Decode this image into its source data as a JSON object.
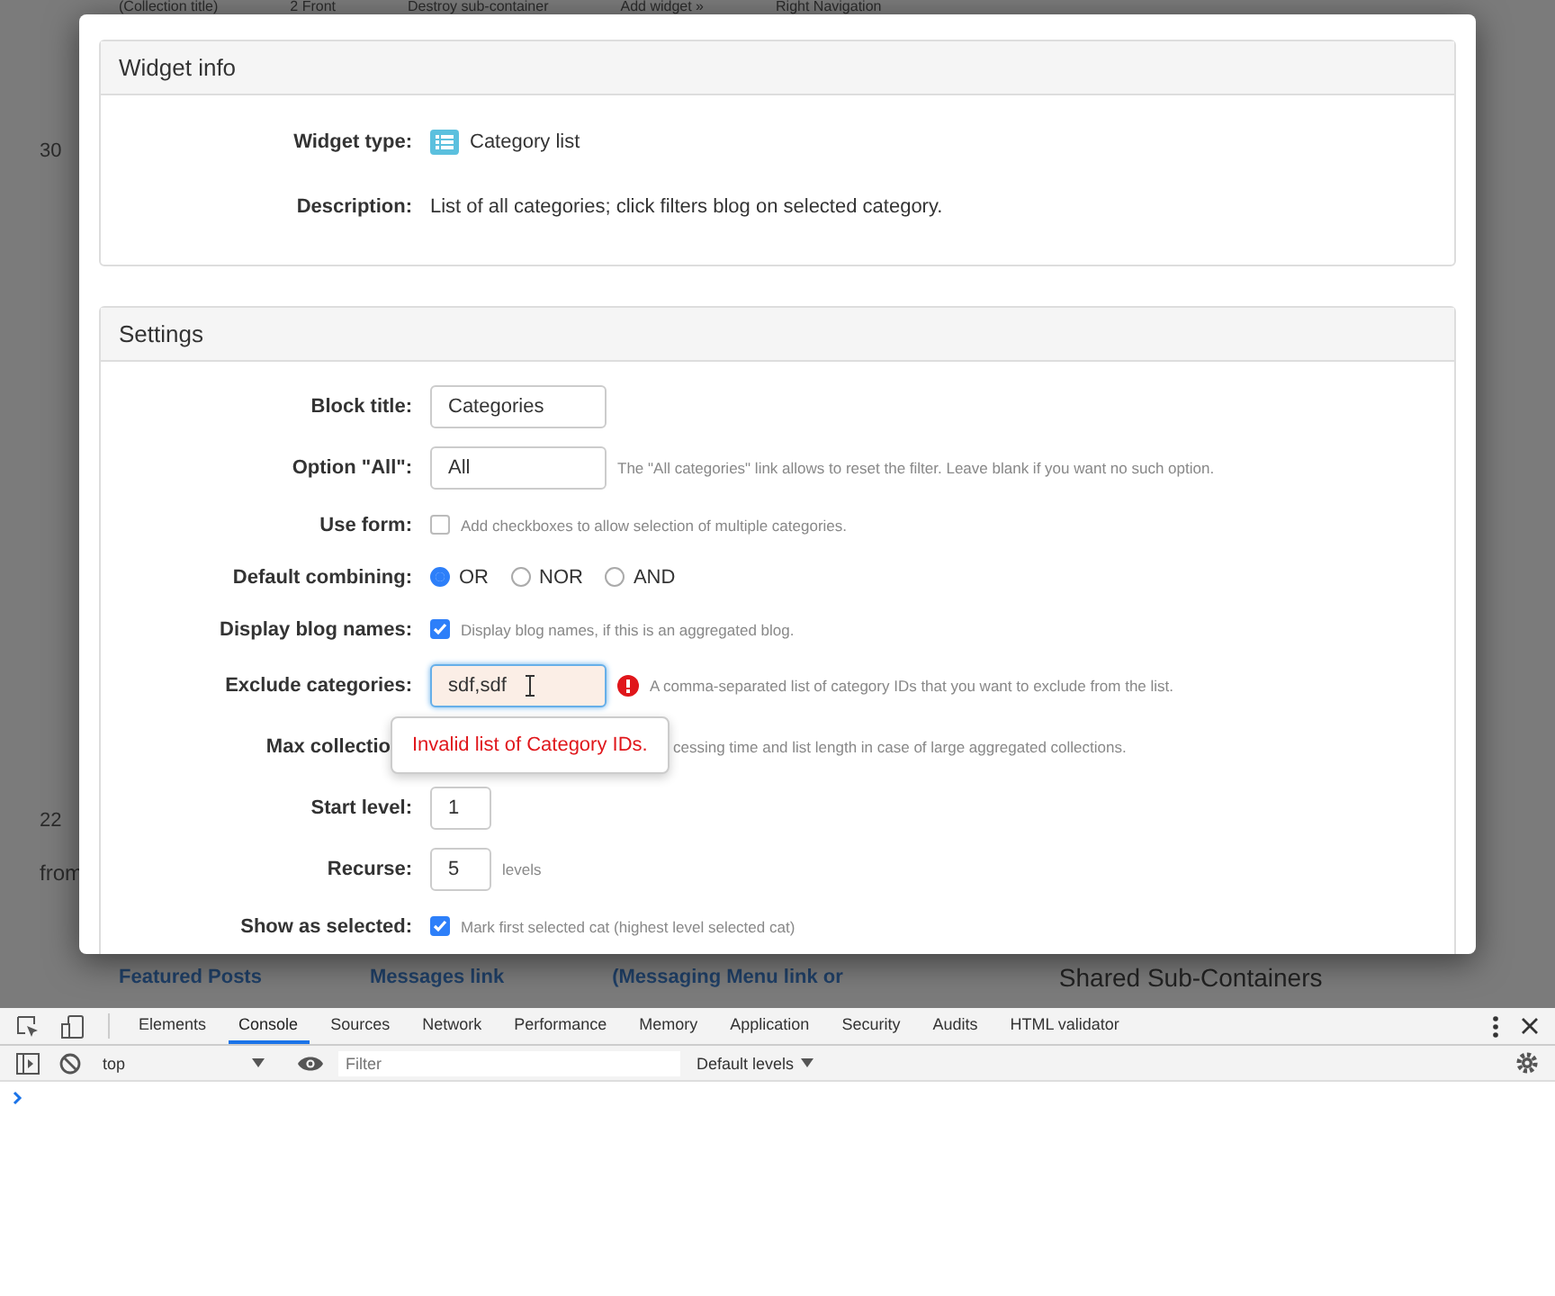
{
  "background_page": {
    "top_items": [
      "(Collection title)",
      "2 Front",
      "Destroy sub-container",
      "Add widget »",
      "Right Navigation"
    ],
    "left_items": [
      {
        "number": "30"
      },
      {
        "number": "22"
      }
    ],
    "left_note": "from",
    "bottom_items": [
      "Featured Posts",
      "Messages link",
      "(Messaging Menu link or"
    ],
    "bottom_heading": "Shared Sub-Containers"
  },
  "modal": {
    "widget_info": {
      "title": "Widget info",
      "rows": [
        {
          "label": "Widget type:",
          "value": "Category list",
          "kind": "type"
        },
        {
          "label": "Description:",
          "value": "List of all categories; click filters blog on selected category.",
          "kind": "text"
        }
      ]
    },
    "settings": {
      "title": "Settings",
      "rows": [
        {
          "kind": "text",
          "label": "Block title:",
          "value": "Categories"
        },
        {
          "kind": "text",
          "label": "Option \"All\":",
          "value": "All",
          "note": "The \"All categories\" link allows to reset the filter. Leave blank if you want no such option."
        },
        {
          "kind": "checkbox",
          "label": "Use form:",
          "checked": false,
          "note": "Add checkboxes to allow selection of multiple categories."
        },
        {
          "kind": "radio",
          "label": "Default combining:",
          "options": [
            {
              "label": "OR",
              "selected": true
            },
            {
              "label": "NOR",
              "selected": false
            },
            {
              "label": "AND",
              "selected": false
            }
          ]
        },
        {
          "kind": "checkbox",
          "label": "Display blog names:",
          "checked": true,
          "note": "Display blog names, if this is an aggregated blog."
        },
        {
          "kind": "text",
          "label": "Exclude categories:",
          "value": "sdf,sdf",
          "error": true,
          "note": "A comma-separated list of category IDs that you want to exclude from the list.",
          "tooltip": "Invalid list of Category IDs."
        },
        {
          "kind": "covered",
          "label": "Max collectio",
          "note": "cessing time and list length in case of large aggregated collections."
        },
        {
          "kind": "number",
          "label": "Start level:",
          "value": "1"
        },
        {
          "kind": "number",
          "label": "Recurse:",
          "value": "5",
          "suffix": "levels"
        },
        {
          "kind": "checkbox",
          "label": "Show as selected:",
          "checked": true,
          "note": "Mark first selected cat (highest level selected cat)"
        }
      ]
    }
  },
  "devtools": {
    "tabs": [
      {
        "label": "Elements",
        "selected": false
      },
      {
        "label": "Console",
        "selected": true
      },
      {
        "label": "Sources",
        "selected": false
      },
      {
        "label": "Network",
        "selected": false
      },
      {
        "label": "Performance",
        "selected": false
      },
      {
        "label": "Memory",
        "selected": false
      },
      {
        "label": "Application",
        "selected": false
      },
      {
        "label": "Security",
        "selected": false
      },
      {
        "label": "Audits",
        "selected": false
      },
      {
        "label": "HTML validator",
        "selected": false
      }
    ],
    "context": "top",
    "filter": {
      "placeholder": "Filter"
    },
    "levels": "Default levels"
  }
}
